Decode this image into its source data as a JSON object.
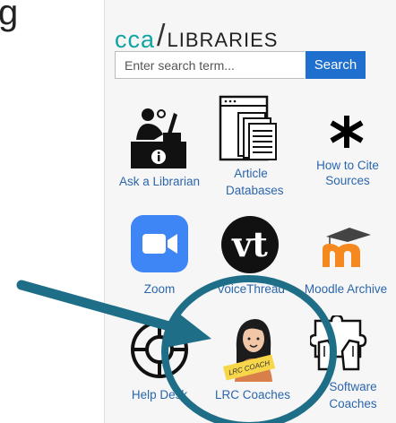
{
  "fragment_text": "g",
  "brand": {
    "cca": "cca",
    "slash": "/",
    "libraries": "LIBRARIES"
  },
  "search": {
    "placeholder": "Enter search term...",
    "button_label": "Search"
  },
  "tiles": [
    {
      "label": "Ask a Librarian",
      "icon": "librarian-desk-icon"
    },
    {
      "label": "Article Databases",
      "icon": "document-stack-icon"
    },
    {
      "label": "How to Cite Sources",
      "icon": "asterisk-icon"
    },
    {
      "label": "Zoom",
      "icon": "zoom-camera-icon"
    },
    {
      "label": "VoiceThread",
      "icon": "voicethread-logo-icon"
    },
    {
      "label": "Moodle Archive",
      "icon": "moodle-logo-icon"
    },
    {
      "label": "Help Desk",
      "icon": "life-ring-icon"
    },
    {
      "label": "LRC Coaches",
      "icon": "lrc-coach-avatar-icon",
      "badge_text": "LRC COACH"
    },
    {
      "label": "Software Coaches",
      "icon": "puzzle-hands-icon"
    }
  ],
  "colors": {
    "brand_teal": "#11a5a3",
    "search_button": "#1f6fce",
    "link": "#2b66ad",
    "annotation": "#1f6e88"
  }
}
